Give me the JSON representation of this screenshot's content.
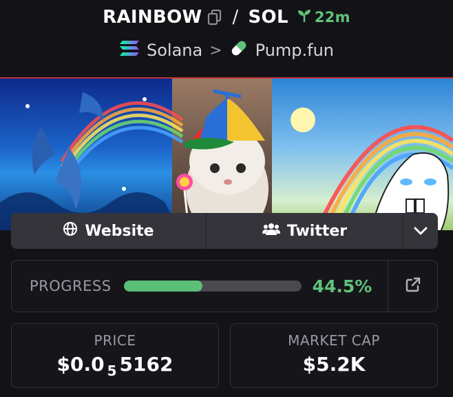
{
  "token": {
    "symbol": "RAINBOW",
    "quote": "SOL",
    "separator": "/",
    "age": "22m"
  },
  "chain": {
    "network": "Solana",
    "separator": ">",
    "platform": "Pump.fun"
  },
  "links": {
    "website_label": "Website",
    "twitter_label": "Twitter"
  },
  "progress": {
    "label": "PROGRESS",
    "value_text": "44.5%",
    "fraction": 0.445
  },
  "stats": {
    "price_label": "PRICE",
    "price_prefix": "$0.0",
    "price_zeros": "5",
    "price_digits": "5162",
    "mcap_label": "MARKET CAP",
    "mcap_value": "$5.2K"
  },
  "colors": {
    "accent_green": "#5fc27a",
    "background": "#131216",
    "card_border": "#34333a"
  },
  "icons": [
    "copy-icon",
    "seedling-icon",
    "solana-icon",
    "chevron-right-icon",
    "pill-icon",
    "globe-icon",
    "users-icon",
    "chevron-down-icon",
    "external-link-icon"
  ]
}
